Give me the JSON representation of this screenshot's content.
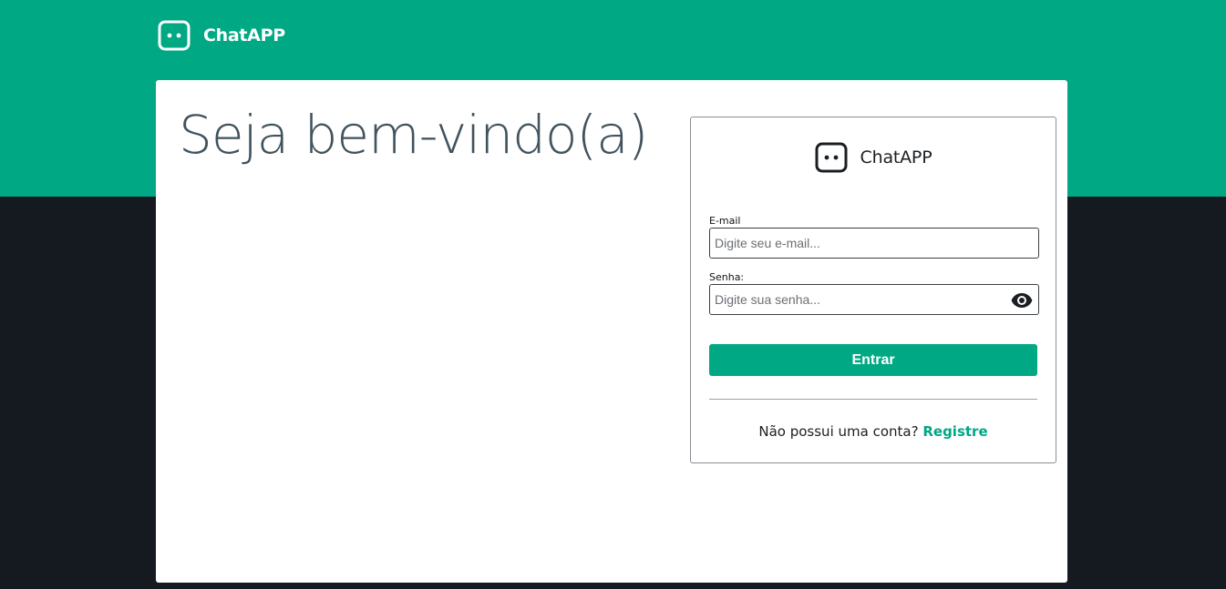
{
  "header": {
    "brand": "ChatAPP",
    "logo_icon": "chat-bubble-dots-icon"
  },
  "main": {
    "welcome_title": "Seja bem-vindo(a)"
  },
  "login": {
    "brand": "ChatAPP",
    "email_label": "E-mail",
    "email_placeholder": "Digite seu e-mail...",
    "email_value": "",
    "password_label": "Senha:",
    "password_placeholder": "Digite sua senha...",
    "password_value": "",
    "show_password_icon": "eye-icon",
    "submit_label": "Entrar",
    "register_prompt": "Não possui uma conta?",
    "register_link": "Registre"
  },
  "colors": {
    "primary": "#00a884",
    "dark_background": "#151a21",
    "title_text": "#41525d"
  }
}
